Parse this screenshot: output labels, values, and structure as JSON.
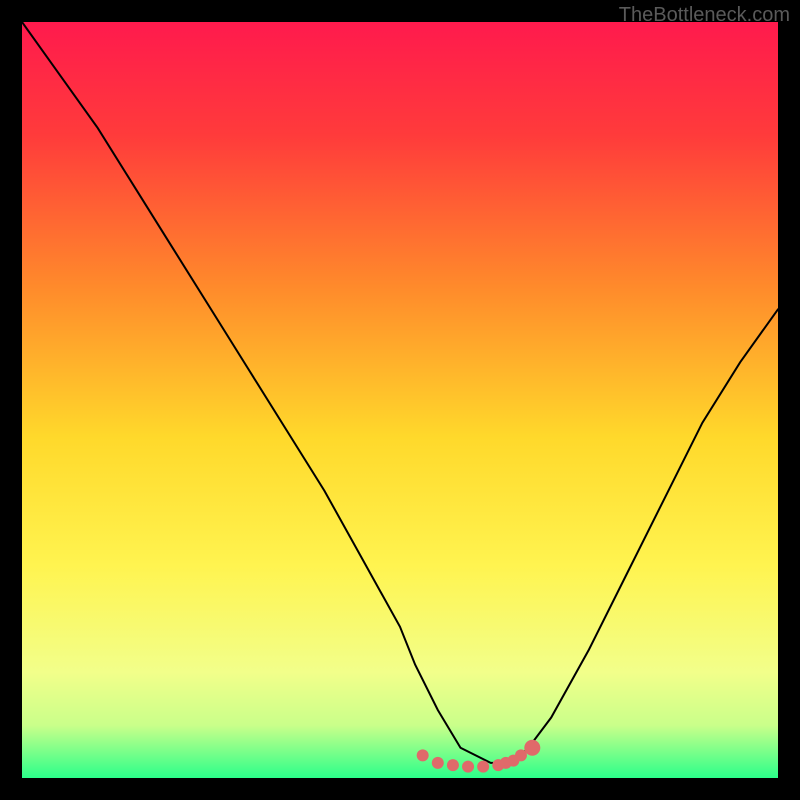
{
  "watermark": "TheBottleneck.com",
  "chart_data": {
    "type": "line",
    "title": "",
    "xlabel": "",
    "ylabel": "",
    "xlim": [
      0,
      100
    ],
    "ylim": [
      0,
      100
    ],
    "background": {
      "type": "vertical-gradient",
      "stops": [
        {
          "pos": 0.0,
          "color": "#ff1a4d"
        },
        {
          "pos": 0.15,
          "color": "#ff3b3b"
        },
        {
          "pos": 0.35,
          "color": "#ff8a2b"
        },
        {
          "pos": 0.55,
          "color": "#ffd92b"
        },
        {
          "pos": 0.72,
          "color": "#fff450"
        },
        {
          "pos": 0.86,
          "color": "#f2ff8a"
        },
        {
          "pos": 0.93,
          "color": "#caff8a"
        },
        {
          "pos": 1.0,
          "color": "#2bff8a"
        }
      ]
    },
    "series": [
      {
        "name": "bottleneck-curve",
        "type": "line",
        "color": "#000000",
        "x": [
          0,
          5,
          10,
          15,
          20,
          25,
          30,
          35,
          40,
          45,
          50,
          52,
          55,
          58,
          62,
          65,
          67,
          70,
          75,
          80,
          85,
          90,
          95,
          100
        ],
        "y": [
          100,
          93,
          86,
          78,
          70,
          62,
          54,
          46,
          38,
          29,
          20,
          15,
          9,
          4,
          2,
          2,
          4,
          8,
          17,
          27,
          37,
          47,
          55,
          62
        ]
      },
      {
        "name": "marker-dot",
        "type": "scatter",
        "color": "#e06a6a",
        "x": [
          67.5
        ],
        "y": [
          4
        ]
      },
      {
        "name": "basin-dots",
        "type": "scatter",
        "color": "#e06a6a",
        "x": [
          53,
          55,
          57,
          59,
          61,
          63,
          64,
          65,
          66
        ],
        "y": [
          3,
          2,
          1.7,
          1.5,
          1.5,
          1.7,
          2,
          2.3,
          3
        ]
      }
    ]
  }
}
